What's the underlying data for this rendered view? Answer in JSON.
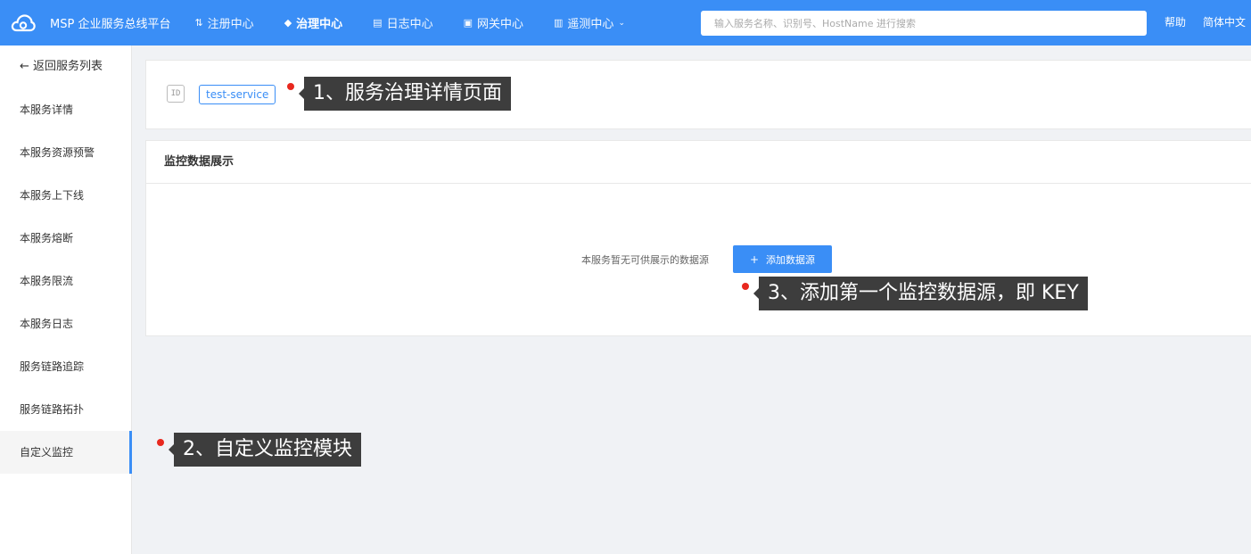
{
  "topbar": {
    "brand": "MSP 企业服务总线平台",
    "nav": [
      {
        "label": "注册中心",
        "icon": "register-icon",
        "active": false
      },
      {
        "label": "治理中心",
        "icon": "layers-icon",
        "active": true
      },
      {
        "label": "日志中心",
        "icon": "log-icon",
        "active": false
      },
      {
        "label": "网关中心",
        "icon": "gateway-icon",
        "active": false
      },
      {
        "label": "遥测中心",
        "icon": "chart-icon",
        "active": false
      }
    ],
    "search_placeholder": "输入服务名称、识别号、HostName 进行搜索",
    "help": "帮助",
    "language": "简体中文",
    "accent_color": "#3a8ef6"
  },
  "sidebar": {
    "back_label": "← 返回服务列表",
    "items": [
      {
        "label": "本服务详情"
      },
      {
        "label": "本服务资源预警"
      },
      {
        "label": "本服务上下线"
      },
      {
        "label": "本服务熔断"
      },
      {
        "label": "本服务限流"
      },
      {
        "label": "本服务日志"
      },
      {
        "label": "服务链路追踪"
      },
      {
        "label": "服务链路拓扑"
      },
      {
        "label": "自定义监控",
        "active": true
      }
    ]
  },
  "service": {
    "id_icon": "ID",
    "name": "test-service"
  },
  "monitor": {
    "title": "监控数据展示",
    "empty_text": "本服务暂无可供展示的数据源",
    "add_button": "添加数据源",
    "add_icon": "+"
  },
  "annotations": [
    {
      "text": "1、服务治理详情页面"
    },
    {
      "text": "2、自定义监控模块"
    },
    {
      "text": "3、添加第一个监控数据源，即 KEY"
    }
  ]
}
